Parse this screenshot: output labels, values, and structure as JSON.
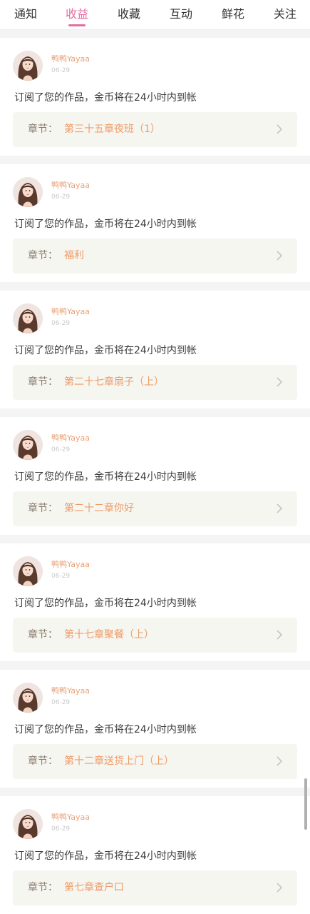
{
  "tabs": [
    {
      "label": "通知"
    },
    {
      "label": "收益"
    },
    {
      "label": "收藏"
    },
    {
      "label": "互动"
    },
    {
      "label": "鲜花"
    },
    {
      "label": "关注"
    }
  ],
  "active_tab_index": 1,
  "colors": {
    "accent": "#e46da1",
    "username": "#e9a277",
    "chapter_title": "#ee9b67",
    "chapter_box": "#f6f6f1"
  },
  "items": [
    {
      "user": "鸭鸭Yayaa",
      "date": "06-29",
      "message": "订阅了您的作品，金币将在24小时内到帐",
      "chapter_label": "章节：",
      "chapter_title": "第三十五章夜班（1）"
    },
    {
      "user": "鸭鸭Yayaa",
      "date": "06-29",
      "message": "订阅了您的作品，金币将在24小时内到帐",
      "chapter_label": "章节：",
      "chapter_title": "福利"
    },
    {
      "user": "鸭鸭Yayaa",
      "date": "06-29",
      "message": "订阅了您的作品，金币将在24小时内到帐",
      "chapter_label": "章节：",
      "chapter_title": "第二十七章扇子（上）"
    },
    {
      "user": "鸭鸭Yayaa",
      "date": "06-29",
      "message": "订阅了您的作品，金币将在24小时内到帐",
      "chapter_label": "章节：",
      "chapter_title": "第二十二章你好"
    },
    {
      "user": "鸭鸭Yayaa",
      "date": "06-29",
      "message": "订阅了您的作品，金币将在24小时内到帐",
      "chapter_label": "章节：",
      "chapter_title": "第十七章聚餐（上）"
    },
    {
      "user": "鸭鸭Yayaa",
      "date": "06-29",
      "message": "订阅了您的作品，金币将在24小时内到帐",
      "chapter_label": "章节：",
      "chapter_title": "第十二章送货上门（上）"
    },
    {
      "user": "鸭鸭Yayaa",
      "date": "06-29",
      "message": "订阅了您的作品，金币将在24小时内到帐",
      "chapter_label": "章节：",
      "chapter_title": "第七章查户口"
    }
  ]
}
